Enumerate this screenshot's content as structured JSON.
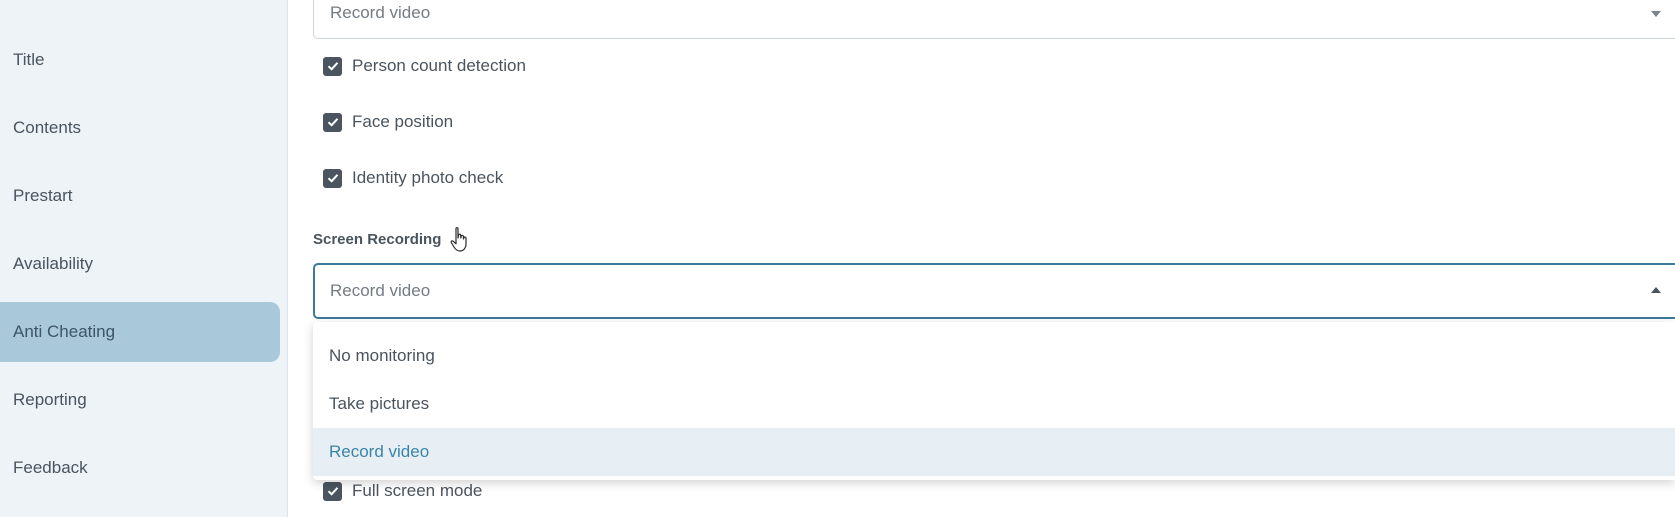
{
  "sidebar": {
    "items": [
      {
        "label": "Title"
      },
      {
        "label": "Contents"
      },
      {
        "label": "Prestart"
      },
      {
        "label": "Availability"
      },
      {
        "label": "Anti Cheating"
      },
      {
        "label": "Reporting"
      },
      {
        "label": "Feedback"
      }
    ],
    "active_item": "Anti Cheating"
  },
  "main": {
    "webcam_select": {
      "value": "Record video"
    },
    "checks": [
      {
        "label": "Person count detection",
        "checked": true
      },
      {
        "label": "Face position",
        "checked": true
      },
      {
        "label": "Identity photo check",
        "checked": true
      }
    ],
    "screen_recording": {
      "label": "Screen Recording",
      "value": "Record video",
      "options": [
        "No monitoring",
        "Take pictures",
        "Record video"
      ],
      "selected": "Record video"
    },
    "full_screen": {
      "label": "Full screen mode",
      "checked": true
    }
  },
  "colors": {
    "accent": "#3b7a99",
    "sidebar_active": "#a9c8da",
    "selected_option_bg": "#e7eff5"
  }
}
